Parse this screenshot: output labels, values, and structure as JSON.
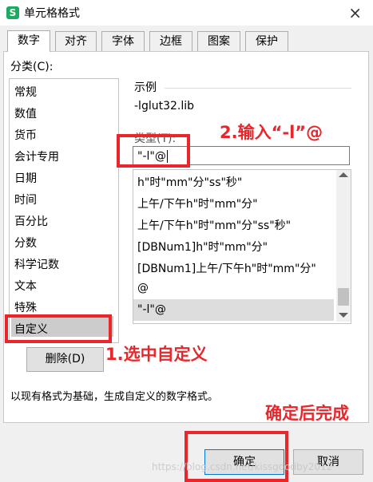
{
  "window": {
    "title": "单元格格式",
    "app_icon": "S",
    "close_icon": "×"
  },
  "tabs": [
    {
      "label": "数字",
      "active": true
    },
    {
      "label": "对齐",
      "active": false
    },
    {
      "label": "字体",
      "active": false
    },
    {
      "label": "边框",
      "active": false
    },
    {
      "label": "图案",
      "active": false
    },
    {
      "label": "保护",
      "active": false
    }
  ],
  "category": {
    "label": "分类(C):",
    "items": [
      "常规",
      "数值",
      "货币",
      "会计专用",
      "日期",
      "时间",
      "百分比",
      "分数",
      "科学记数",
      "文本",
      "特殊",
      "自定义"
    ],
    "selected": "自定义"
  },
  "sample": {
    "label": "示例",
    "value": "-lglut32.lib"
  },
  "type": {
    "label": "类型(T):",
    "value": "\"-l\"@",
    "options": [
      "h\"时\"mm\"分\"ss\"秒\"",
      "上午/下午h\"时\"mm\"分\"",
      "上午/下午h\"时\"mm\"分\"ss\"秒\"",
      "[DBNum1]h\"时\"mm\"分\"",
      "[DBNum1]上午/下午h\"时\"mm\"分\"",
      "@",
      "\"-l\"@"
    ],
    "selected": "\"-l\"@"
  },
  "buttons": {
    "delete": "删除(D)",
    "ok": "确定",
    "cancel": "取消"
  },
  "description": "以现有格式为基础，生成自定义的数字格式。",
  "annotations": {
    "step1": "1.选中自定义",
    "step2": "2.输入“-l”@",
    "step3": "确定后完成",
    "color": "#e8262b"
  },
  "watermark": "https://blog.csdn.net/kissgoodby2012"
}
